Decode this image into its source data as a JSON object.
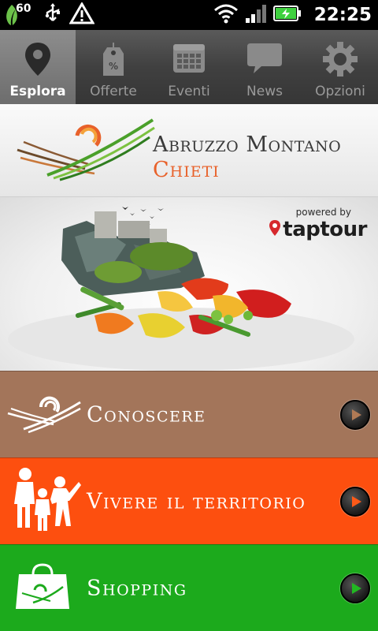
{
  "status_bar": {
    "notification_count": "60",
    "time": "22:25",
    "icons": [
      "leaf-notification-icon",
      "usb-icon",
      "warning-icon",
      "wifi-icon",
      "signal-icon",
      "battery-charging-icon"
    ]
  },
  "tabs": [
    {
      "label": "Esplora",
      "icon": "location-pin-icon",
      "active": true
    },
    {
      "label": "Offerte",
      "icon": "price-tag-icon",
      "active": false
    },
    {
      "label": "Eventi",
      "icon": "calendar-icon",
      "active": false
    },
    {
      "label": "News",
      "icon": "speech-bubble-icon",
      "active": false
    },
    {
      "label": "Opzioni",
      "icon": "gear-icon",
      "active": false
    }
  ],
  "header": {
    "title": "Abruzzo Montano",
    "subtitle": "Chieti"
  },
  "hero": {
    "powered_by": "powered by",
    "brand": "taptour"
  },
  "menu": [
    {
      "label": "Conoscere",
      "color": "#a3755a",
      "icon": "brush-strokes-icon"
    },
    {
      "label": "Vivere il territorio",
      "color": "#fd4f0f",
      "icon": "family-icon"
    },
    {
      "label": "Shopping",
      "color": "#1caa1c",
      "icon": "shopping-bag-icon"
    }
  ],
  "colors": {
    "accent_orange": "#e8612a",
    "tab_bar": "#404040"
  }
}
